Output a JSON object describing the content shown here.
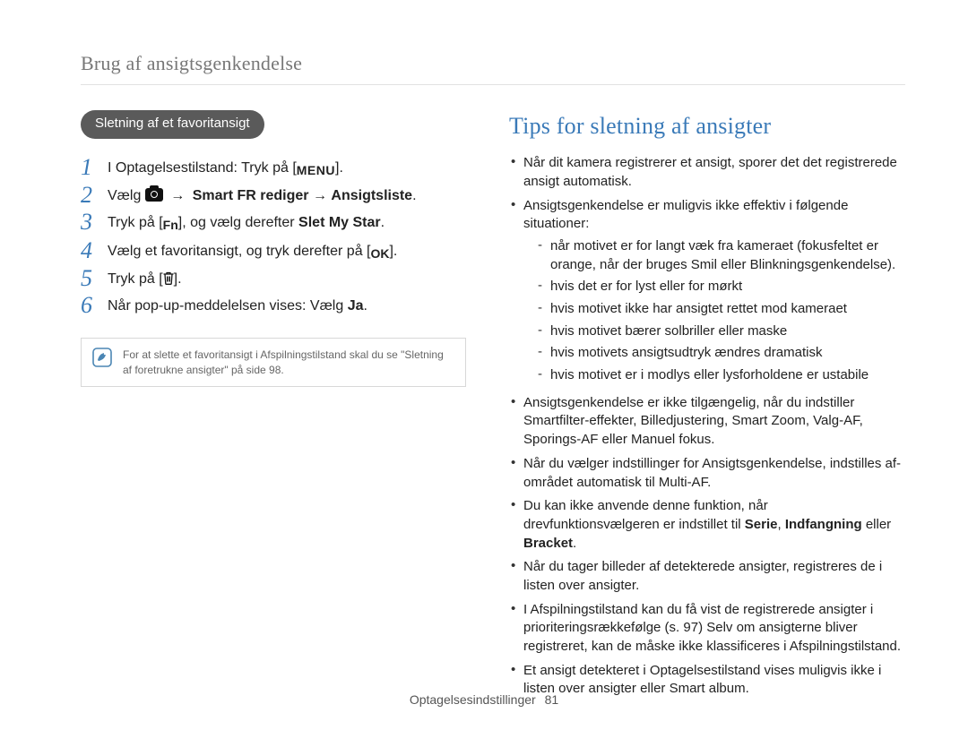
{
  "breadcrumb": "Brug af ansigtsgenkendelse",
  "pill_label": "Sletning af et favoritansigt",
  "steps": [
    {
      "pre": "I Optagelsestilstand: Tryk på [",
      "glyph": "MENU",
      "post": "]."
    },
    {
      "pre": "Vælg ",
      "glyph": "camera",
      "arrow": " → ",
      "bold1": "Smart FR rediger",
      "mid": " → ",
      "bold2": "Ansigtsliste",
      "post": "."
    },
    {
      "pre": "Tryk på [",
      "glyph": "Fn",
      "mid": "], og vælg derefter ",
      "bold1": "Slet My Star",
      "post": "."
    },
    {
      "pre": "Vælg et favoritansigt, og tryk derefter på [",
      "glyph": "OK",
      "post": "]."
    },
    {
      "pre": "Tryk på [",
      "glyph": "trash",
      "post": "]."
    },
    {
      "pre": "Når pop-up-meddelelsen vises: Vælg ",
      "bold1": "Ja",
      "post": "."
    }
  ],
  "note": "For at slette et favoritansigt i Afspilningstilstand skal du se \"Sletning af foretrukne ansigter\" på side 98.",
  "tips_heading": "Tips for sletning af ansigter",
  "tips": {
    "b1": "Når dit kamera registrerer et ansigt, sporer det det registrerede ansigt automatisk.",
    "b2": "Ansigtsgenkendelse er muligvis ikke effektiv i følgende situationer:",
    "dashes": [
      "når motivet er for langt væk fra kameraet (fokusfeltet er orange, når der bruges Smil eller Blinkningsgenkendelse).",
      "hvis det er for lyst eller for mørkt",
      "hvis motivet ikke har ansigtet rettet mod kameraet",
      "hvis motivet bærer solbriller eller maske",
      "hvis motivets ansigtsudtryk ændres dramatisk",
      "hvis motivet er i modlys eller lysforholdene er ustabile"
    ],
    "b3": "Ansigtsgenkendelse er ikke tilgængelig, når du indstiller Smartfilter-effekter, Billedjustering, Smart Zoom, Valg-AF, Sporings-AF eller Manuel fokus.",
    "b4": "Når du vælger indstillinger for Ansigtsgenkendelse, indstilles af-området automatisk til Multi-AF.",
    "b5_pre": "Du kan ikke anvende denne funktion, når drevfunktionsvælgeren er indstillet til ",
    "b5_bold1": "Serie",
    "b5_sep1": ", ",
    "b5_bold2": "Indfangning",
    "b5_sep2": " eller ",
    "b5_bold3": "Bracket",
    "b5_post": ".",
    "b6": "Når du tager billeder af detekterede ansigter, registreres de i listen over ansigter.",
    "b7": "I Afspilningstilstand kan du få vist de registrerede ansigter i prioriteringsrækkefølge (s. 97) Selv om ansigterne bliver registreret, kan de måske ikke klassificeres i Afspilningstilstand.",
    "b8": "Et ansigt detekteret i Optagelsestilstand vises muligvis ikke i listen over ansigter eller Smart album."
  },
  "footer_label": "Optagelsesindstillinger",
  "page_number": "81"
}
